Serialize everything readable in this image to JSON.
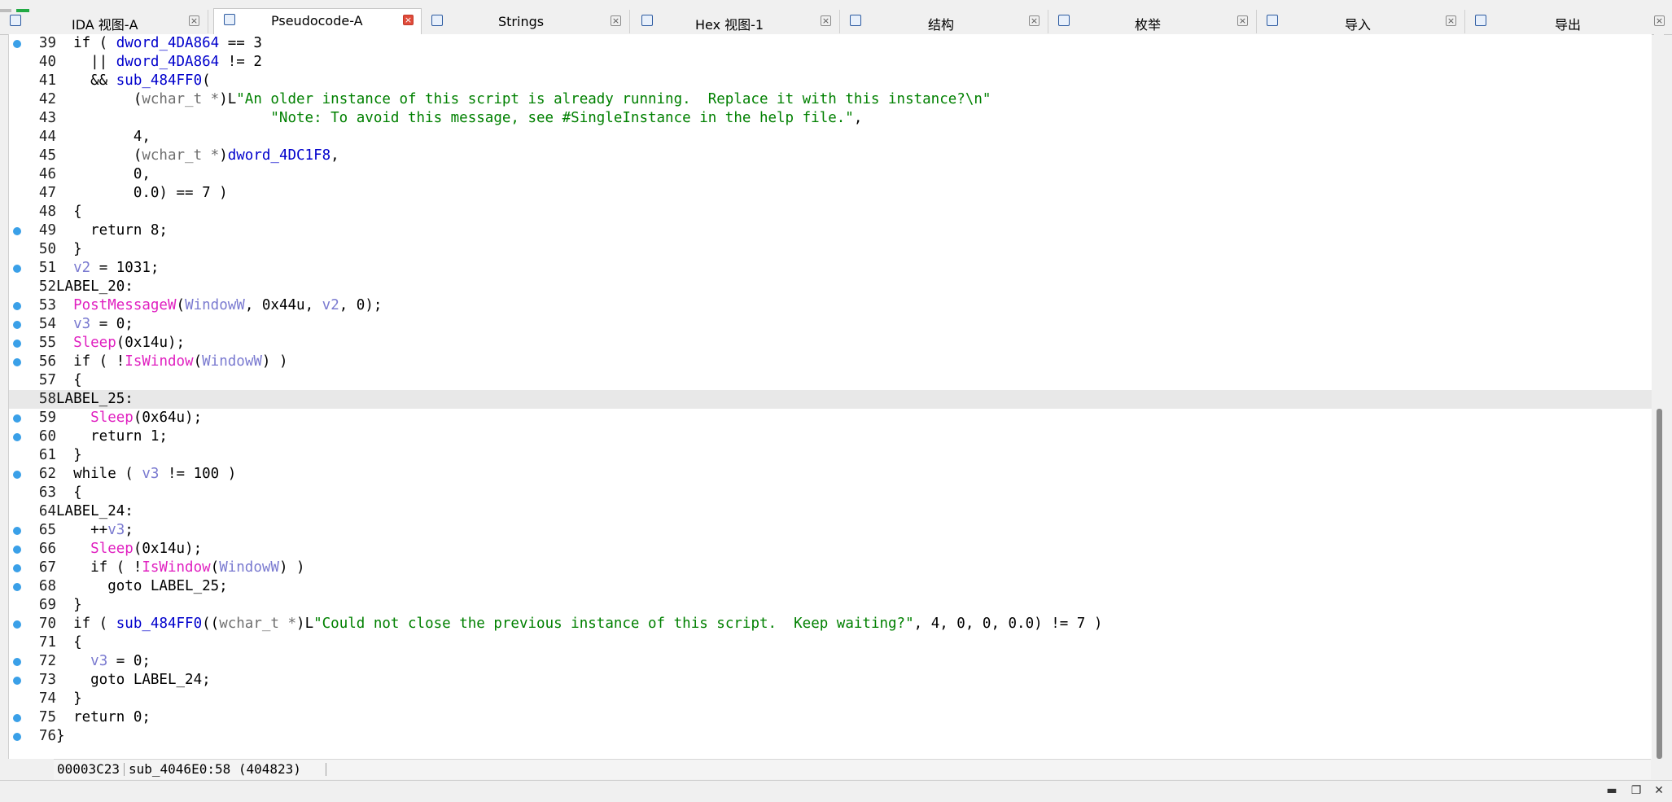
{
  "tabs": [
    {
      "label": "IDA 视图-A",
      "icon": "disasm-view-icon",
      "active": false
    },
    {
      "label": "Pseudocode-A",
      "icon": "pseudocode-icon",
      "active": true
    },
    {
      "label": "Strings",
      "icon": "strings-icon",
      "active": false
    },
    {
      "label": "Hex 视图-1",
      "icon": "hex-view-icon",
      "active": false
    },
    {
      "label": "结构",
      "icon": "structures-icon",
      "active": false
    },
    {
      "label": "枚举",
      "icon": "enums-icon",
      "active": false
    },
    {
      "label": "导入",
      "icon": "imports-icon",
      "active": false
    },
    {
      "label": "导出",
      "icon": "exports-icon",
      "active": false
    }
  ],
  "tab_close_glyph": "×",
  "colors": {
    "number_text": "#000000",
    "string": "#008000",
    "global": "#0000cc",
    "local_var": "#7a7ad0",
    "api_function": "#e020c0",
    "cast_type": "#707070",
    "breakpoint_dot": "#3aa0e8",
    "active_tab_close": "#e04b3a",
    "highlight_line": "#e8e8e8"
  },
  "code_lines": [
    {
      "num": "39",
      "bp": true,
      "tokens": [
        [
          "t",
          "  if ( "
        ],
        [
          "g",
          "dword_4DA864"
        ],
        [
          "t",
          " == 3"
        ]
      ]
    },
    {
      "num": "40",
      "bp": false,
      "tokens": [
        [
          "t",
          "    || "
        ],
        [
          "g",
          "dword_4DA864"
        ],
        [
          "t",
          " != 2"
        ]
      ]
    },
    {
      "num": "41",
      "bp": false,
      "tokens": [
        [
          "t",
          "    && "
        ],
        [
          "g",
          "sub_484FF0"
        ],
        [
          "t",
          "("
        ]
      ]
    },
    {
      "num": "42",
      "bp": false,
      "tokens": [
        [
          "t",
          "         ("
        ],
        [
          "c",
          "wchar_t *"
        ],
        [
          "t",
          ")L"
        ],
        [
          "s",
          "\"An older instance of this script is already running.  Replace it with this instance?\\n\""
        ]
      ]
    },
    {
      "num": "43",
      "bp": false,
      "tokens": [
        [
          "s",
          "                         \"Note: To avoid this message, see #SingleInstance in the help file.\""
        ],
        [
          "t",
          ","
        ]
      ]
    },
    {
      "num": "44",
      "bp": false,
      "tokens": [
        [
          "t",
          "         4,"
        ]
      ]
    },
    {
      "num": "45",
      "bp": false,
      "tokens": [
        [
          "t",
          "         ("
        ],
        [
          "c",
          "wchar_t *"
        ],
        [
          "t",
          ")"
        ],
        [
          "g",
          "dword_4DC1F8"
        ],
        [
          "t",
          ","
        ]
      ]
    },
    {
      "num": "46",
      "bp": false,
      "tokens": [
        [
          "t",
          "         0,"
        ]
      ]
    },
    {
      "num": "47",
      "bp": false,
      "tokens": [
        [
          "t",
          "         0.0) == 7 )"
        ]
      ]
    },
    {
      "num": "48",
      "bp": false,
      "tokens": [
        [
          "t",
          "  {"
        ]
      ]
    },
    {
      "num": "49",
      "bp": true,
      "tokens": [
        [
          "t",
          "    return 8;"
        ]
      ]
    },
    {
      "num": "50",
      "bp": false,
      "tokens": [
        [
          "t",
          "  }"
        ]
      ]
    },
    {
      "num": "51",
      "bp": true,
      "tokens": [
        [
          "t",
          "  "
        ],
        [
          "v",
          "v2"
        ],
        [
          "t",
          " = 1031;"
        ]
      ]
    },
    {
      "num": "52",
      "bp": false,
      "tokens": [
        [
          "t",
          "LABEL_20:"
        ]
      ]
    },
    {
      "num": "53",
      "bp": true,
      "tokens": [
        [
          "t",
          "  "
        ],
        [
          "f",
          "PostMessageW"
        ],
        [
          "t",
          "("
        ],
        [
          "v",
          "WindowW"
        ],
        [
          "t",
          ", 0x44u, "
        ],
        [
          "v",
          "v2"
        ],
        [
          "t",
          ", 0);"
        ]
      ]
    },
    {
      "num": "54",
      "bp": true,
      "tokens": [
        [
          "t",
          "  "
        ],
        [
          "v",
          "v3"
        ],
        [
          "t",
          " = 0;"
        ]
      ]
    },
    {
      "num": "55",
      "bp": true,
      "tokens": [
        [
          "t",
          "  "
        ],
        [
          "f",
          "Sleep"
        ],
        [
          "t",
          "(0x14u);"
        ]
      ]
    },
    {
      "num": "56",
      "bp": true,
      "tokens": [
        [
          "t",
          "  if ( !"
        ],
        [
          "f",
          "IsWindow"
        ],
        [
          "t",
          "("
        ],
        [
          "v",
          "WindowW"
        ],
        [
          "t",
          ") )"
        ]
      ]
    },
    {
      "num": "57",
      "bp": false,
      "tokens": [
        [
          "t",
          "  {"
        ]
      ]
    },
    {
      "num": "58",
      "bp": false,
      "hl": true,
      "tokens": [
        [
          "t",
          "LABEL_25:"
        ]
      ]
    },
    {
      "num": "59",
      "bp": true,
      "tokens": [
        [
          "t",
          "    "
        ],
        [
          "f",
          "Sleep"
        ],
        [
          "t",
          "(0x64u);"
        ]
      ]
    },
    {
      "num": "60",
      "bp": true,
      "tokens": [
        [
          "t",
          "    return 1;"
        ]
      ]
    },
    {
      "num": "61",
      "bp": false,
      "tokens": [
        [
          "t",
          "  }"
        ]
      ]
    },
    {
      "num": "62",
      "bp": true,
      "tokens": [
        [
          "t",
          "  while ( "
        ],
        [
          "v",
          "v3"
        ],
        [
          "t",
          " != 100 )"
        ]
      ]
    },
    {
      "num": "63",
      "bp": false,
      "tokens": [
        [
          "t",
          "  {"
        ]
      ]
    },
    {
      "num": "64",
      "bp": false,
      "tokens": [
        [
          "t",
          "LABEL_24:"
        ]
      ]
    },
    {
      "num": "65",
      "bp": true,
      "tokens": [
        [
          "t",
          "    ++"
        ],
        [
          "v",
          "v3"
        ],
        [
          "t",
          ";"
        ]
      ]
    },
    {
      "num": "66",
      "bp": true,
      "tokens": [
        [
          "t",
          "    "
        ],
        [
          "f",
          "Sleep"
        ],
        [
          "t",
          "(0x14u);"
        ]
      ]
    },
    {
      "num": "67",
      "bp": true,
      "tokens": [
        [
          "t",
          "    if ( !"
        ],
        [
          "f",
          "IsWindow"
        ],
        [
          "t",
          "("
        ],
        [
          "v",
          "WindowW"
        ],
        [
          "t",
          ") )"
        ]
      ]
    },
    {
      "num": "68",
      "bp": true,
      "tokens": [
        [
          "t",
          "      goto LABEL_25;"
        ]
      ]
    },
    {
      "num": "69",
      "bp": false,
      "tokens": [
        [
          "t",
          "  }"
        ]
      ]
    },
    {
      "num": "70",
      "bp": true,
      "tokens": [
        [
          "t",
          "  if ( "
        ],
        [
          "g",
          "sub_484FF0"
        ],
        [
          "t",
          "(("
        ],
        [
          "c",
          "wchar_t *"
        ],
        [
          "t",
          ")L"
        ],
        [
          "s",
          "\"Could not close the previous instance of this script.  Keep waiting?\""
        ],
        [
          "t",
          ", 4, 0, 0, 0.0) != 7 )"
        ]
      ]
    },
    {
      "num": "71",
      "bp": false,
      "tokens": [
        [
          "t",
          "  {"
        ]
      ]
    },
    {
      "num": "72",
      "bp": true,
      "tokens": [
        [
          "t",
          "    "
        ],
        [
          "v",
          "v3"
        ],
        [
          "t",
          " = 0;"
        ]
      ]
    },
    {
      "num": "73",
      "bp": true,
      "tokens": [
        [
          "t",
          "    goto LABEL_24;"
        ]
      ]
    },
    {
      "num": "74",
      "bp": false,
      "tokens": [
        [
          "t",
          "  }"
        ]
      ]
    },
    {
      "num": "75",
      "bp": true,
      "tokens": [
        [
          "t",
          "  return 0;"
        ]
      ]
    },
    {
      "num": "76",
      "bp": true,
      "tokens": [
        [
          "t",
          "}"
        ]
      ]
    }
  ],
  "status": {
    "address": "00003C23",
    "location": "sub_4046E0:58 (404823)"
  },
  "window_controls": {
    "minimize": "▬",
    "restore": "❐",
    "close": "✕"
  }
}
